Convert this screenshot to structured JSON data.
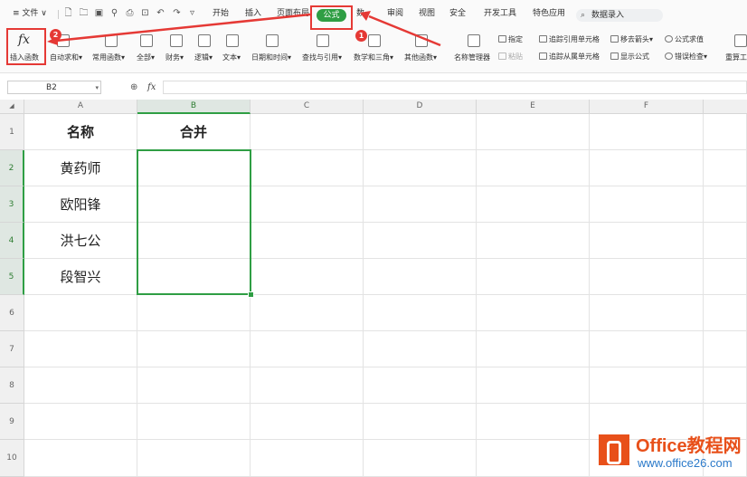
{
  "menubar": {
    "file": "文件",
    "tabs": [
      {
        "label": "开始"
      },
      {
        "label": "插入"
      },
      {
        "label": "页面布局"
      },
      {
        "label": "公式",
        "active": true
      },
      {
        "label": "数"
      },
      {
        "label": "审阅"
      },
      {
        "label": "视图"
      },
      {
        "label": "安全"
      },
      {
        "label": "开发工具"
      },
      {
        "label": "特色应用"
      }
    ],
    "search": "数据录入"
  },
  "ribbon": {
    "insert_function": "插入函数",
    "autosum": "自动求和",
    "common": "常用函数",
    "all": "全部",
    "finance": "财务",
    "logic": "逻辑",
    "text": "文本",
    "datetime": "日期和时间",
    "lookup": "查找与引用",
    "math": "数学和三角",
    "other": "其他函数",
    "name_manager": "名称管理器",
    "define": "指定",
    "paste": "粘贴",
    "trace_precedents": "追踪引用单元格",
    "trace_dependents": "追踪从属单元格",
    "remove_arrows": "移去箭头",
    "show_formulas": "显示公式",
    "formula_eval": "公式求值",
    "error_check": "错误检查",
    "recalc": "重算工"
  },
  "formula_bar": {
    "name_box": "B2",
    "fx": "fx",
    "formula": ""
  },
  "columns": [
    "A",
    "B",
    "C",
    "D",
    "E",
    "F"
  ],
  "selected_column": "B",
  "rows": [
    "1",
    "2",
    "3",
    "4",
    "5",
    "6",
    "7",
    "8",
    "9",
    "10"
  ],
  "selected_rows": [
    "2",
    "3",
    "4",
    "5"
  ],
  "cells": {
    "A1": "名称",
    "B1": "合并",
    "A2": "黄药师",
    "A3": "欧阳锋",
    "A4": "洪七公",
    "A5": "段智兴"
  },
  "annotations": {
    "step1": "1",
    "step2": "2",
    "color": "#e53935"
  },
  "watermark": {
    "title": "Office教程网",
    "url": "www.office26.com"
  },
  "colors": {
    "accent": "#2f9e44",
    "annotation": "#e53935",
    "brand": "#e8501a"
  }
}
